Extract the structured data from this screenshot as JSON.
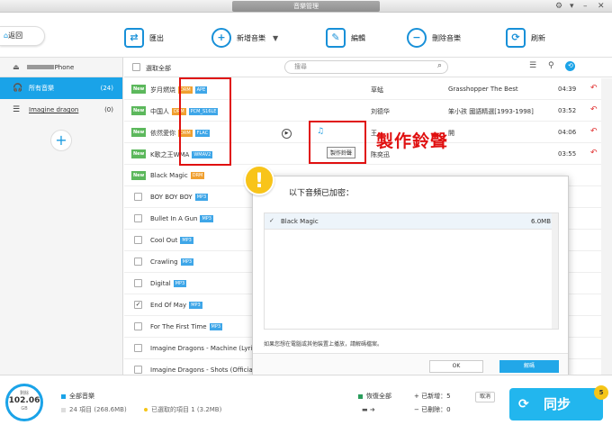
{
  "window": {
    "title": "音樂管理"
  },
  "toolbar": {
    "back": "返回",
    "buttons": [
      {
        "label": "匯出",
        "icon": "export-icon"
      },
      {
        "label": "新增音樂",
        "icon": "add-music-icon"
      },
      {
        "label": "編輯",
        "icon": "edit-icon"
      },
      {
        "label": "刪除音樂",
        "icon": "delete-music-icon"
      },
      {
        "label": "刷新",
        "icon": "refresh-icon"
      }
    ]
  },
  "sidebar": {
    "device_name": "Phone",
    "items": [
      {
        "label": "所有音樂",
        "count": "(24)"
      },
      {
        "label": "Imagine dragon",
        "count": "(0)"
      }
    ]
  },
  "list": {
    "select_all": "選取全部",
    "search_placeholder": "搜尋",
    "rows": [
      {
        "title": "岁月燃烧",
        "new": "New",
        "tags": [
          "DRM",
          "APE"
        ],
        "artist": "草蜢",
        "album": "Grasshopper The Best",
        "time": "04:39",
        "checkbox": false
      },
      {
        "title": "中国人",
        "new": "New",
        "tags": [
          "DRM",
          "PCM_S16LE"
        ],
        "artist": "刘德华",
        "album": "笨小孩 國語精選[1993-1998]",
        "time": "03:52",
        "checkbox": false
      },
      {
        "title": "依然愛你",
        "new": "New",
        "tags": [
          "DRM",
          "FLAC"
        ],
        "artist": "王",
        "album": "開",
        "time": "04:06",
        "checkbox": false
      },
      {
        "title": "K歌之王WMA",
        "new": "New",
        "tags": [
          "WMAV2"
        ],
        "artist": "陈奕迅",
        "album": "",
        "time": "03:55",
        "checkbox": false
      },
      {
        "title": "Black Magic",
        "new": "New",
        "tags": [
          "DRM"
        ],
        "artist": "",
        "album": "",
        "time": "",
        "checkbox": false
      },
      {
        "title": "BOY BOY BOY",
        "new": "",
        "tags": [
          "MP3"
        ],
        "artist": "",
        "album": "",
        "time": "",
        "checkbox": false
      },
      {
        "title": "Bullet In A Gun",
        "new": "",
        "tags": [
          "MP3"
        ],
        "artist": "",
        "album": "",
        "time": "",
        "checkbox": false
      },
      {
        "title": "Cool Out",
        "new": "",
        "tags": [
          "MP3"
        ],
        "artist": "",
        "album": "",
        "time": "",
        "checkbox": false
      },
      {
        "title": "Crawling",
        "new": "",
        "tags": [
          "MP3"
        ],
        "artist": "",
        "album": "",
        "time": "",
        "checkbox": false
      },
      {
        "title": "Digital",
        "new": "",
        "tags": [
          "MP3"
        ],
        "artist": "",
        "album": "",
        "time": "",
        "checkbox": false
      },
      {
        "title": "End Of May",
        "new": "",
        "tags": [
          "MP3"
        ],
        "artist": "",
        "album": "",
        "time": "",
        "checkbox": true
      },
      {
        "title": "For The First Time",
        "new": "",
        "tags": [
          "MP3"
        ],
        "artist": "",
        "album": "",
        "time": "",
        "checkbox": false
      },
      {
        "title": "Imagine Dragons - Machine (Lyrics",
        "new": "",
        "tags": [],
        "artist": "",
        "album": "",
        "time": "",
        "checkbox": false
      },
      {
        "title": "Imagine Dragons - Shots (Official M",
        "new": "",
        "tags": [],
        "artist": "",
        "album": "",
        "time": "",
        "checkbox": false
      }
    ],
    "ringtone_tooltip": "製作鈴聲"
  },
  "annotation": {
    "text": "製作鈴聲"
  },
  "dialog": {
    "title": "以下音頻已加密：",
    "items": [
      {
        "name": "Black Magic",
        "size": "6.0MB",
        "checked": true
      }
    ],
    "note": "如果您想在電腦或其他裝置上播放，請解碼檔案。",
    "ok": "OK",
    "unlock": "解碼"
  },
  "footer": {
    "storage_label": "剩餘",
    "storage_value": "102.06",
    "storage_unit": "GB",
    "all_music": "全部音樂",
    "all_music_detail": "24 項目 (268.6MB)",
    "selected": "已選取的項目 1 (3.2MB)",
    "restore_all": "恢復全部",
    "added": "已新增：5",
    "deleted": "已刪除：0",
    "cancel": "取消",
    "sync": "同步",
    "badge": "5",
    "colors": {
      "accent": "#1aa3e8",
      "drm": "#f0a030",
      "fmt": "#3ea6e8",
      "new": "#5cb85c",
      "annotation": "#e01010"
    }
  }
}
